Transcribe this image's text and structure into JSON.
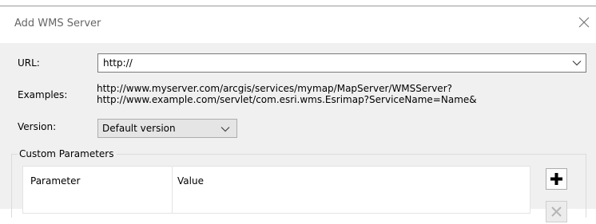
{
  "dialog": {
    "title": "Add WMS Server"
  },
  "form": {
    "url_label": "URL:",
    "url_value": "http://",
    "examples_label": "Examples:",
    "examples": [
      "http://www.myserver.com/arcgis/services/mymap/MapServer/WMSServer?",
      "http://www.example.com/servlet/com.esri.wms.Esrimap?ServiceName=Name&"
    ],
    "version_label": "Version:",
    "version_value": "Default version"
  },
  "custom_parameters": {
    "group_label": "Custom Parameters",
    "columns": [
      "Parameter",
      "Value"
    ]
  },
  "icons": {
    "close": "close-icon",
    "dropdown": "chevron-down-icon",
    "add": "plus-icon",
    "remove": "remove-icon"
  }
}
